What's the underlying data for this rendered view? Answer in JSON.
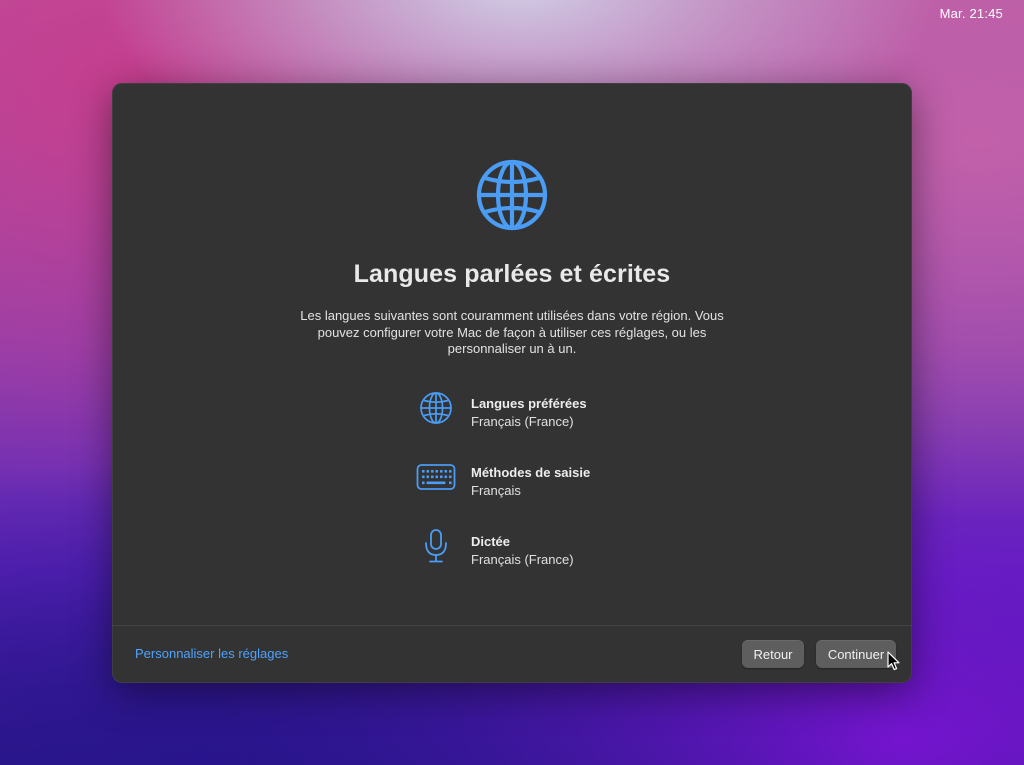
{
  "menubar": {
    "clock": "Mar. 21:45"
  },
  "dialog": {
    "hero_icon": "globe-icon",
    "title": "Langues parlées et écrites",
    "description": "Les langues suivantes sont couramment utilisées dans votre région. Vous pouvez configurer votre Mac de façon à utiliser ces réglages, ou les personnaliser un à un.",
    "settings": [
      {
        "icon": "globe-icon",
        "title": "Langues préférées",
        "value": "Français (France)"
      },
      {
        "icon": "keyboard-icon",
        "title": "Méthodes de saisie",
        "value": "Français"
      },
      {
        "icon": "microphone-icon",
        "title": "Dictée",
        "value": "Français (France)"
      }
    ],
    "customize_link": "Personnaliser les réglages",
    "back_button": "Retour",
    "continue_button": "Continuer"
  },
  "colors": {
    "accent": "#4a9cf5",
    "link": "#4da3ff",
    "dialog_background": "#333333",
    "button_background": "#5e5e5e"
  }
}
